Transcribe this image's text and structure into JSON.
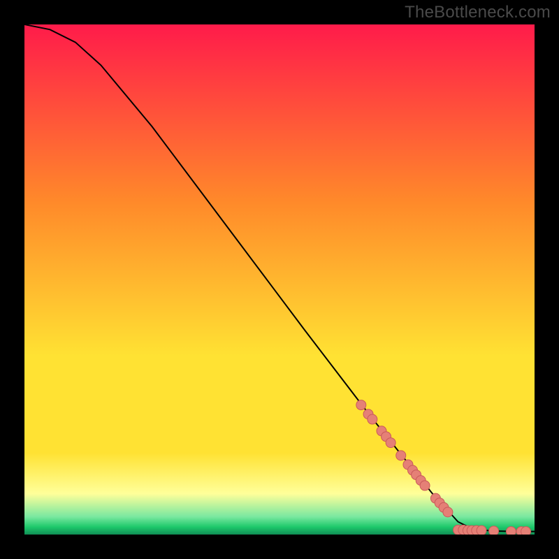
{
  "attribution": "TheBottleneck.com",
  "colors": {
    "frame": "#000000",
    "curve": "#000000",
    "marker_fill": "#e58076",
    "marker_stroke": "#c95a5a",
    "gradient_top": "#ff1b4a",
    "gradient_mid1": "#ff8a2a",
    "gradient_mid2": "#ffe233",
    "gradient_lightband": "#ffff9a",
    "gradient_green_light": "#7ae8a0",
    "gradient_green": "#1ec96b",
    "gradient_green_dark": "#0f8f55"
  },
  "chart_data": {
    "type": "line",
    "title": "",
    "xlabel": "",
    "ylabel": "",
    "xlim": [
      0,
      100
    ],
    "ylim": [
      0,
      100
    ],
    "grid": false,
    "curve": [
      {
        "x": 0,
        "y": 100
      },
      {
        "x": 5,
        "y": 99
      },
      {
        "x": 10,
        "y": 96.5
      },
      {
        "x": 15,
        "y": 92
      },
      {
        "x": 25,
        "y": 80
      },
      {
        "x": 40,
        "y": 60
      },
      {
        "x": 55,
        "y": 40
      },
      {
        "x": 68,
        "y": 23
      },
      {
        "x": 80,
        "y": 8
      },
      {
        "x": 85,
        "y": 2.5
      },
      {
        "x": 88,
        "y": 1
      },
      {
        "x": 92,
        "y": 0.7
      },
      {
        "x": 96,
        "y": 0.6
      },
      {
        "x": 100,
        "y": 0.6
      }
    ],
    "marker_radius_px": 7,
    "markers": [
      {
        "x": 66.0,
        "y": 25.4
      },
      {
        "x": 67.4,
        "y": 23.6
      },
      {
        "x": 68.2,
        "y": 22.6
      },
      {
        "x": 70.0,
        "y": 20.3
      },
      {
        "x": 70.9,
        "y": 19.2
      },
      {
        "x": 71.8,
        "y": 18.0
      },
      {
        "x": 73.8,
        "y": 15.5
      },
      {
        "x": 75.2,
        "y": 13.7
      },
      {
        "x": 76.1,
        "y": 12.6
      },
      {
        "x": 76.8,
        "y": 11.7
      },
      {
        "x": 77.7,
        "y": 10.6
      },
      {
        "x": 78.5,
        "y": 9.6
      },
      {
        "x": 80.6,
        "y": 7.1
      },
      {
        "x": 81.4,
        "y": 6.2
      },
      {
        "x": 82.2,
        "y": 5.3
      },
      {
        "x": 83.0,
        "y": 4.4
      },
      {
        "x": 85.0,
        "y": 0.9
      },
      {
        "x": 86.0,
        "y": 0.9
      },
      {
        "x": 86.9,
        "y": 0.8
      },
      {
        "x": 87.7,
        "y": 0.8
      },
      {
        "x": 88.6,
        "y": 0.8
      },
      {
        "x": 89.6,
        "y": 0.8
      },
      {
        "x": 92.0,
        "y": 0.7
      },
      {
        "x": 95.4,
        "y": 0.6
      },
      {
        "x": 97.4,
        "y": 0.6
      },
      {
        "x": 98.3,
        "y": 0.6
      }
    ]
  }
}
